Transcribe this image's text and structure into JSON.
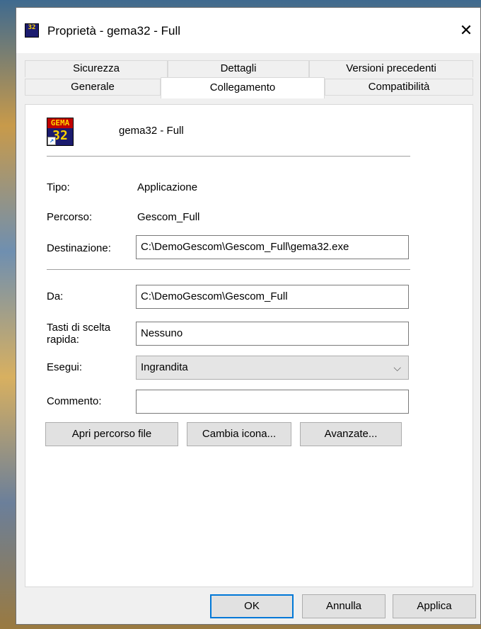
{
  "window": {
    "title": "Proprietà - gema32 - Full",
    "close_glyph": "✕"
  },
  "tabs_row1": [
    "Sicurezza",
    "Dettagli",
    "Versioni precedenti"
  ],
  "tabs_row2": [
    "Generale",
    "Collegamento",
    "Compatibilità"
  ],
  "active_tab": "Collegamento",
  "app": {
    "name": "gema32 - Full",
    "icon": "gema32-app-icon",
    "icon_text_top": "GEMA",
    "icon_text_bottom": "32"
  },
  "fields": {
    "tipo_label": "Tipo:",
    "tipo_value": "Applicazione",
    "percorso_label": "Percorso:",
    "percorso_value": "Gescom_Full",
    "destinazione_label": "Destinazione:",
    "destinazione_value": "C:\\DemoGescom\\Gescom_Full\\gema32.exe",
    "da_label": "Da:",
    "da_value": "C:\\DemoGescom\\Gescom_Full",
    "tasti_label_line1": "Tasti di scelta",
    "tasti_label_line2": "rapida:",
    "tasti_value": "Nessuno",
    "esegui_label": "Esegui:",
    "esegui_value": "Ingrandita",
    "commento_label": "Commento:",
    "commento_value": ""
  },
  "buttons": {
    "apri_percorso": "Apri percorso file",
    "cambia_icona": "Cambia icona...",
    "avanzate": "Avanzate...",
    "ok": "OK",
    "annulla": "Annulla",
    "applica": "Applica"
  },
  "colors": {
    "focus_border": "#0078d7",
    "panel_bg": "#ffffff",
    "window_bg": "#f0f0f0"
  }
}
